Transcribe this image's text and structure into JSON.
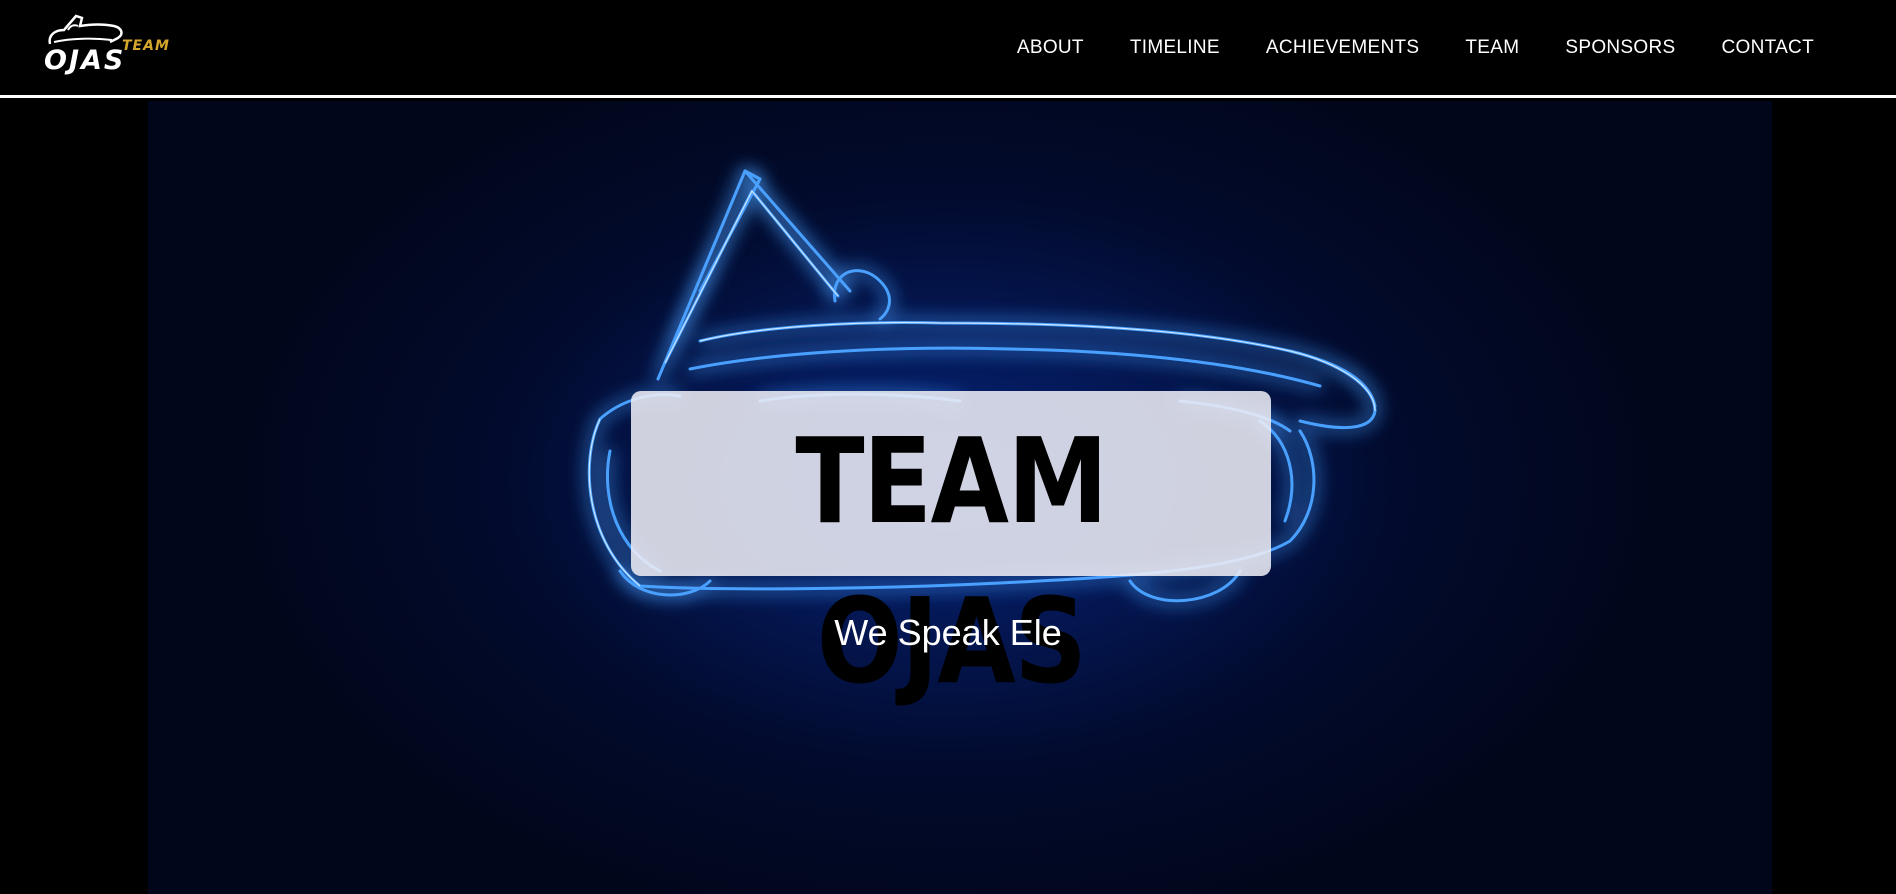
{
  "header": {
    "logo": {
      "icon": "car-outline-icon",
      "small_text": "TEAM",
      "big_text": "OJAS",
      "accent_color": "#d4a72c"
    },
    "nav": [
      {
        "label": "ABOUT"
      },
      {
        "label": "TIMELINE"
      },
      {
        "label": "ACHIEVEMENTS"
      },
      {
        "label": "TEAM"
      },
      {
        "label": "SPONSORS"
      },
      {
        "label": "CONTACT"
      }
    ]
  },
  "hero": {
    "title": "TEAM OJAS",
    "tagline": "We Speak Ele",
    "glow_color": "#1f6bff",
    "background_color": "#041650"
  }
}
